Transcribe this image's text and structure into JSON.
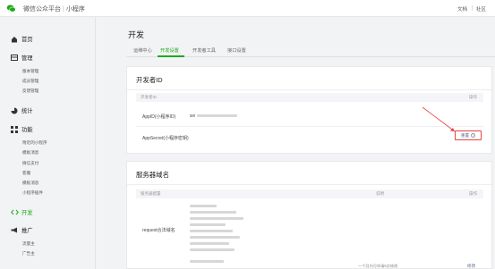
{
  "topbar": {
    "brand": "微信公众平台",
    "product": "小程序",
    "links": [
      "文档",
      "社区"
    ]
  },
  "sidebar": {
    "sections": [
      {
        "label": "首页",
        "icon": "home-icon"
      },
      {
        "label": "管理",
        "icon": "folder-icon",
        "items": [
          "版本管理",
          "成员管理",
          "反馈管理"
        ]
      },
      {
        "label": "统计",
        "icon": "chart-icon"
      },
      {
        "label": "功能",
        "icon": "grid-icon",
        "items": [
          "附近的小程序",
          "模板消息",
          "微信支付",
          "客服",
          "模板消息",
          "小程序插件"
        ]
      },
      {
        "label": "开发",
        "icon": "code-icon",
        "active": true
      },
      {
        "label": "推广",
        "icon": "megaphone-icon",
        "items": [
          "流量主",
          "广告主"
        ]
      }
    ]
  },
  "main": {
    "title": "开发",
    "tabs": [
      "运维中心",
      "开发设置",
      "开发者工具",
      "接口设置"
    ],
    "active_tab": 1,
    "dev_id": {
      "title": "开发者ID",
      "col_item": "开发者ID",
      "col_op": "操作",
      "appid_label": "AppID(小程序ID)",
      "appid_value": "wx",
      "secret_label": "AppSecret(小程序密钥)",
      "reset": "重置"
    },
    "server": {
      "title": "服务器域名",
      "col_config": "服务器配置",
      "col_desc": "说明",
      "col_op": "操作",
      "request_label": "request合法域名",
      "desc_note": "一个月内可申请5次修改",
      "op_label": "修改"
    }
  },
  "colors": {
    "accent": "#1aad19",
    "link": "#576b95",
    "annotation": "#e64340"
  }
}
